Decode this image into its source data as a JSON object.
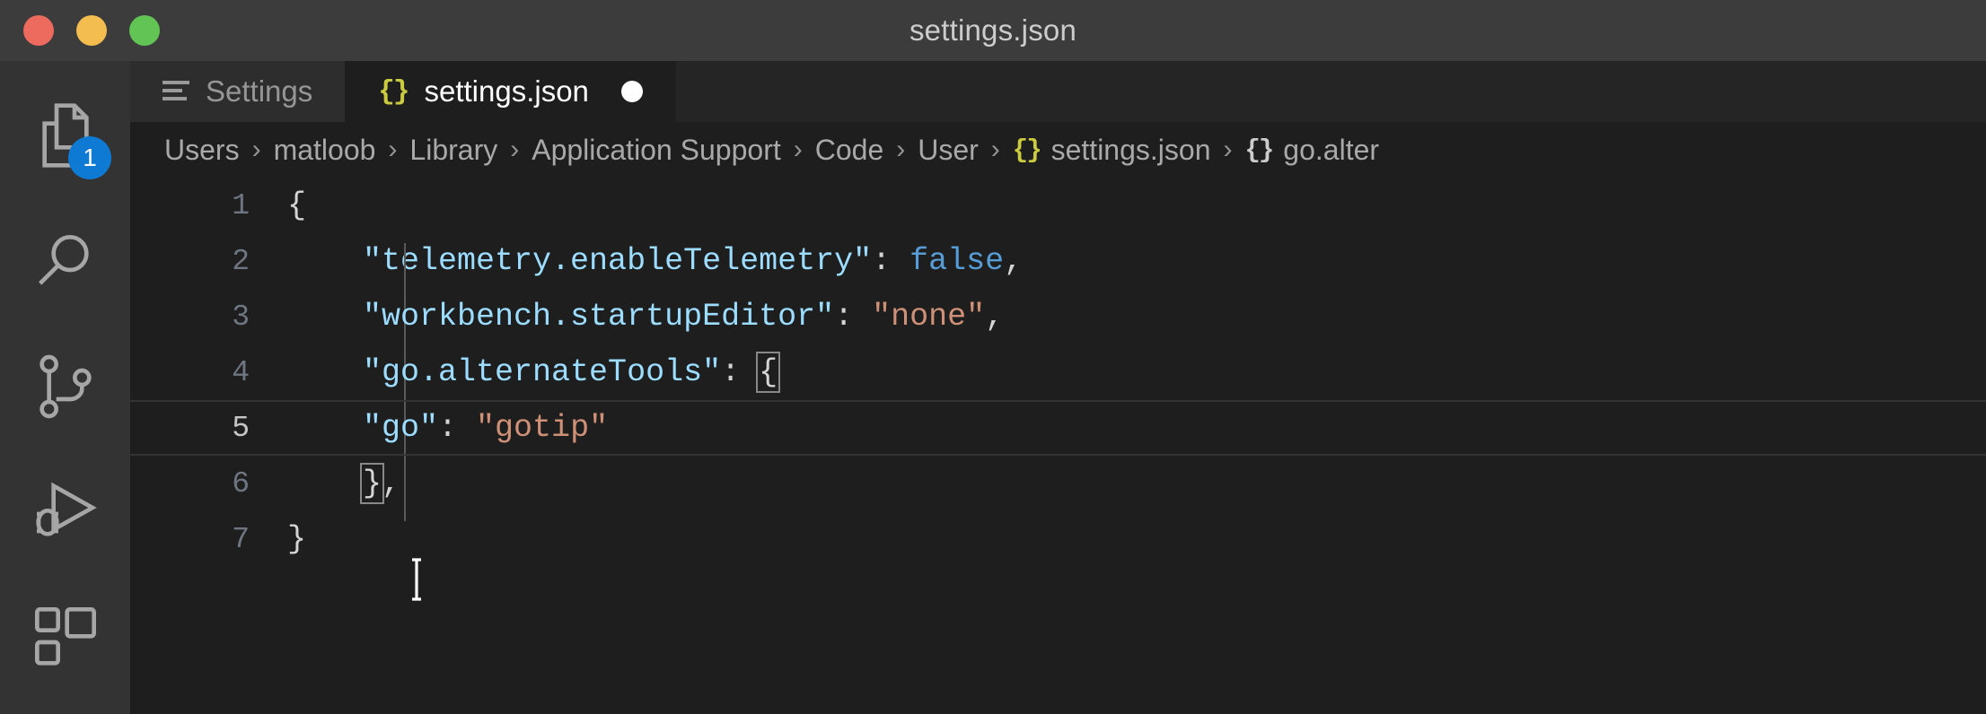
{
  "window": {
    "title": "settings.json",
    "traffic_lights": [
      {
        "name": "close",
        "color": "#ed6a5f"
      },
      {
        "name": "minimize",
        "color": "#f4bd4f"
      },
      {
        "name": "zoom",
        "color": "#61c454"
      }
    ]
  },
  "activity_bar": {
    "items": [
      {
        "icon": "explorer-files-icon",
        "label": "Explorer",
        "badge": "1"
      },
      {
        "icon": "search-icon",
        "label": "Search",
        "badge": ""
      },
      {
        "icon": "source-control-branch-icon",
        "label": "Source Control",
        "badge": ""
      },
      {
        "icon": "run-and-debug-icon",
        "label": "Run and Debug",
        "badge": ""
      },
      {
        "icon": "extensions-icon",
        "label": "Extensions",
        "badge": ""
      }
    ],
    "badge_color": "#0e7ad4"
  },
  "tabs": [
    {
      "label": "Settings",
      "icon": "settings-lines-icon",
      "active": false,
      "dirty": false
    },
    {
      "label": "settings.json",
      "icon": "json-braces-icon",
      "active": true,
      "dirty": true
    }
  ],
  "breadcrumb": {
    "separator": "›",
    "items": [
      {
        "label": "Users",
        "icon": ""
      },
      {
        "label": "matloob",
        "icon": ""
      },
      {
        "label": "Library",
        "icon": ""
      },
      {
        "label": "Application Support",
        "icon": ""
      },
      {
        "label": "Code",
        "icon": ""
      },
      {
        "label": "User",
        "icon": ""
      },
      {
        "label": "settings.json",
        "icon": "{}"
      },
      {
        "label": "go.alter",
        "icon": "{}"
      }
    ]
  },
  "editor": {
    "language": "json",
    "active_line": 5,
    "lines": [
      {
        "n": "1",
        "tokens": [
          {
            "t": "{",
            "c": "p"
          }
        ]
      },
      {
        "n": "2",
        "tokens": [
          {
            "t": "    ",
            "c": "p"
          },
          {
            "t": "\"telemetry.enableTelemetry\"",
            "c": "k"
          },
          {
            "t": ": ",
            "c": "p"
          },
          {
            "t": "false",
            "c": "b"
          },
          {
            "t": ",",
            "c": "p"
          }
        ]
      },
      {
        "n": "3",
        "tokens": [
          {
            "t": "    ",
            "c": "p"
          },
          {
            "t": "\"workbench.startupEditor\"",
            "c": "k"
          },
          {
            "t": ": ",
            "c": "p"
          },
          {
            "t": "\"none\"",
            "c": "s"
          },
          {
            "t": ",",
            "c": "p"
          }
        ]
      },
      {
        "n": "4",
        "tokens": [
          {
            "t": "    ",
            "c": "p"
          },
          {
            "t": "\"go.alternateTools\"",
            "c": "k"
          },
          {
            "t": ": ",
            "c": "p"
          },
          {
            "t": "{",
            "c": "p brk"
          }
        ]
      },
      {
        "n": "5",
        "tokens": [
          {
            "t": "    ",
            "c": "p"
          },
          {
            "t": "\"go\"",
            "c": "k"
          },
          {
            "t": ": ",
            "c": "p"
          },
          {
            "t": "\"gotip\"",
            "c": "s"
          }
        ]
      },
      {
        "n": "6",
        "tokens": [
          {
            "t": "    ",
            "c": "p"
          },
          {
            "t": "}",
            "c": "p brk"
          },
          {
            "t": ",",
            "c": "p"
          }
        ]
      },
      {
        "n": "7",
        "tokens": [
          {
            "t": "}",
            "c": "p"
          }
        ]
      }
    ],
    "colors": {
      "background": "#1e1e1e",
      "key": "#9cdcfe",
      "string": "#ce9178",
      "boolean": "#569cd6",
      "punctuation": "#d4d4d4",
      "line_number": "#6e7681",
      "active_line_number": "#c6c6c6"
    }
  }
}
